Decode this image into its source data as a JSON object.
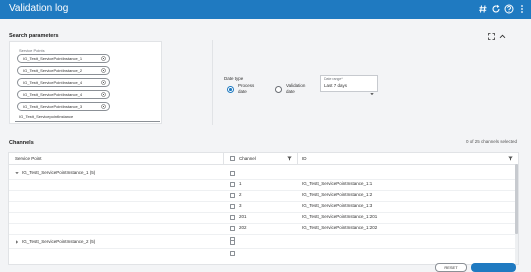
{
  "app": {
    "title": "Validation log"
  },
  "header_icons": [
    "hash-icon",
    "refresh-icon",
    "help-icon",
    "more-vertical-icon"
  ],
  "search": {
    "title": "Search parameters",
    "service_points_label": "Service Points",
    "chips": [
      "IG_Testt_ServicePointInstance_1",
      "IG_Testt_ServicePointInstance_2",
      "IG_Testt_ServicePointInstance_4",
      "IG_Testt_ServicePointInstance_4",
      "IG_Testt_ServicePointInstance_3"
    ],
    "input_value": "IG_Testt_ServicepointInstance",
    "date_type": {
      "label": "Date type",
      "options": [
        "Process date",
        "Validation date"
      ],
      "selected": "Process date"
    },
    "date_range": {
      "caption": "Date range*",
      "value": "Last 7 days"
    }
  },
  "channels": {
    "title": "Channels",
    "count_text": "0 of 25 channels selected",
    "columns": {
      "service_point": "Service Point",
      "channel": "Channel",
      "id": "ID"
    },
    "groups": [
      {
        "name": "IG_Testt_ServicePointInstance_1 (5)",
        "expanded": true,
        "rows": [
          {
            "channel": "1",
            "id": "IG_Testt_ServicePointInstance_1:1"
          },
          {
            "channel": "2",
            "id": "IG_Testt_ServicePointInstance_1:2"
          },
          {
            "channel": "3",
            "id": "IG_Testt_ServicePointInstance_1:3"
          },
          {
            "channel": "201",
            "id": "IG_Testt_ServicePointInstance_1:201"
          },
          {
            "channel": "202",
            "id": "IG_Testt_ServicePointInstance_1:202"
          }
        ]
      },
      {
        "name": "IG_Testt_ServicePointInstance_2 (5)",
        "expanded": false,
        "rows": []
      }
    ]
  },
  "footer": {
    "reset_label": "RESET"
  },
  "colors": {
    "brand": "#1f7ac1",
    "background": "#f3f4f6"
  }
}
